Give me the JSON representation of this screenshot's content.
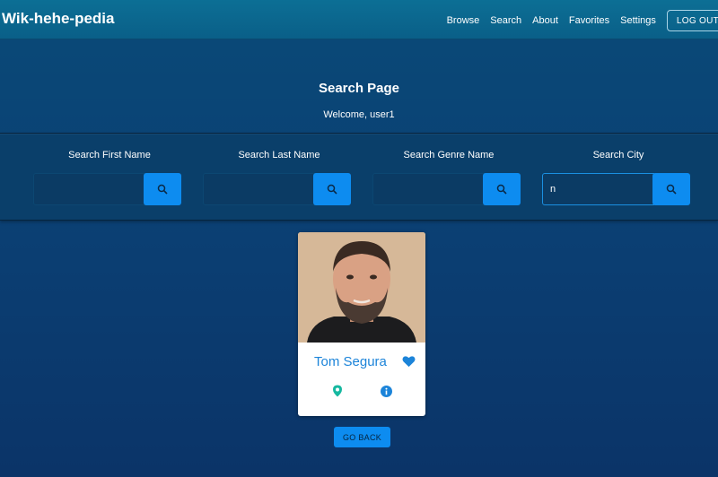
{
  "navbar": {
    "brand": "Wik-hehe-pedia",
    "links": [
      "Browse",
      "Search",
      "About",
      "Favorites",
      "Settings"
    ],
    "logout_label": "LOG OUT"
  },
  "hero": {
    "title": "Search Page",
    "welcome": "Welcome, user1"
  },
  "search": {
    "fields": [
      {
        "label": "Search First Name",
        "value": ""
      },
      {
        "label": "Search Last Name",
        "value": ""
      },
      {
        "label": "Search Genre Name",
        "value": ""
      },
      {
        "label": "Search City",
        "value": "n"
      }
    ],
    "button_icon": "search-icon"
  },
  "result_card": {
    "name": "Tom Segura",
    "favorite_icon": "heart-icon",
    "location_icon": "map-pin-icon",
    "info_icon": "info-icon"
  },
  "go_back_label": "GO BACK",
  "colors": {
    "accent": "#0d8cf0",
    "navbar": "#0a6a90",
    "background": "#0b3f73",
    "pin": "#16b8a0"
  }
}
